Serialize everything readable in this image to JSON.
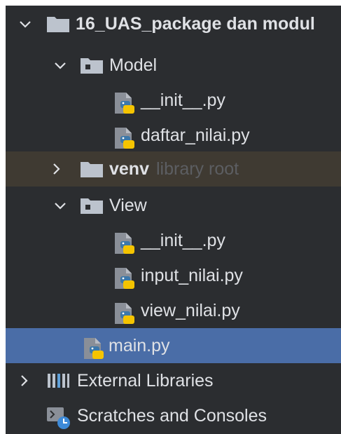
{
  "project_tree": {
    "root": {
      "label": "16_UAS_package dan modul"
    },
    "model_folder": {
      "label": "Model"
    },
    "model_init": {
      "label": "__init__.py"
    },
    "model_daftar": {
      "label": "daftar_nilai.py"
    },
    "venv": {
      "label": "venv",
      "hint": "library root"
    },
    "view_folder": {
      "label": "View"
    },
    "view_init": {
      "label": "__init__.py"
    },
    "view_input": {
      "label": "input_nilai.py"
    },
    "view_view": {
      "label": "view_nilai.py"
    },
    "main_file": {
      "label": "main.py"
    },
    "external_libraries": {
      "label": "External Libraries"
    },
    "scratches": {
      "label": "Scratches and Consoles"
    }
  },
  "colors": {
    "panel_background": "#2b2d30",
    "text": "#dfe1e5",
    "selected_row": "#4a6da7",
    "excluded_row": "#3f3a32",
    "hint_text": "#5c5e62",
    "folder_icon": "#bcc3cd",
    "python_blue": "#3c78aa",
    "python_yellow": "#f5c400"
  },
  "icons": {
    "expanded": "chevron-down-icon",
    "collapsed": "chevron-right-icon",
    "folder": "folder-icon",
    "package": "package-folder-icon",
    "python_file": "python-file-icon",
    "libraries": "libraries-icon",
    "scratches": "scratches-icon"
  }
}
